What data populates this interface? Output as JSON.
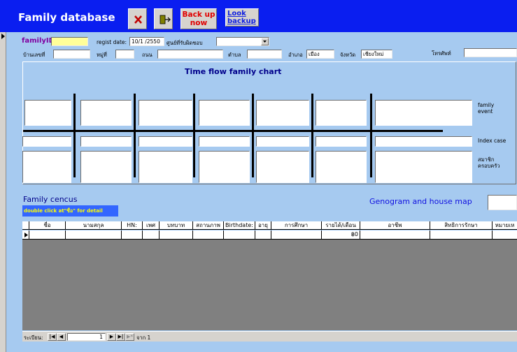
{
  "header": {
    "title": "Family database",
    "backup_label": "Back up now",
    "look_backup_label": "Look backup"
  },
  "form": {
    "family_id_label": "familyID",
    "family_id_value": "",
    "regist_date_label": "regist date:",
    "regist_date_value": "10/1 /2550",
    "center_label": "ศูนย์ที่รับผิดชอบ",
    "center_value": "",
    "house_no_label": "บ้านเลขที่",
    "moo_label": "หมู่ที่",
    "road_label": "ถนน",
    "tambon_label": "ตำบล",
    "amphoe_label": "อำเภอ",
    "amphoe_value": "เมือง",
    "province_label": "จังหวัด",
    "province_value": "เชียงใหม่",
    "phone_label": "โทรศัพท์"
  },
  "chart": {
    "title": "Time flow family  chart",
    "family_event_label": "family event",
    "index_case_label": "Index case",
    "members_label": "สมาชิก ครอบครัว"
  },
  "census": {
    "title": "Family cencus",
    "hint": "double click at\"ชื่อ\" for detail",
    "genogram_label": "Genogram and house map",
    "columns": [
      "ชื่อ",
      "นามสกุล",
      "HN:",
      "เพศ",
      "บทบาท",
      "สถานภาพ",
      "Birthdate:",
      "อายุ",
      "การศึกษา",
      "รายได้/เดือน",
      "อาชีพ",
      "สิทธิการรักษา",
      "หมายเห"
    ],
    "row_income": "฿0"
  },
  "nav": {
    "record_label": "ระเบียน:",
    "current": "1",
    "of_label": "จาก 1"
  }
}
